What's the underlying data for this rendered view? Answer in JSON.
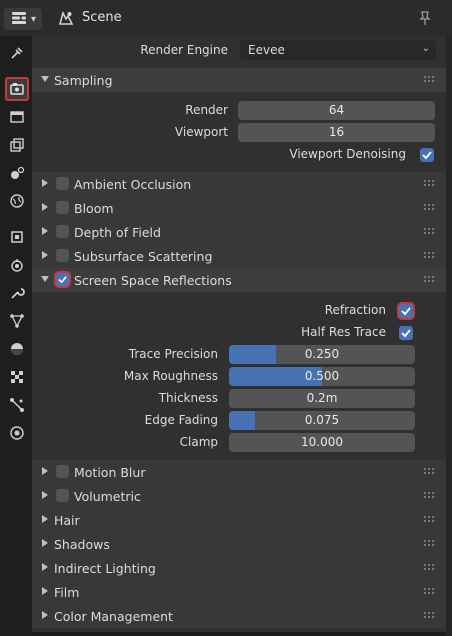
{
  "header": {
    "title": "Scene"
  },
  "tabs": [
    "tool-icon",
    "render-icon",
    "output-icon",
    "view-layer-icon",
    "scene-icon",
    "world-icon",
    "object-icon",
    "modifier-icon",
    "wrench-icon",
    "particles-icon",
    "physics-icon",
    "texture-icon",
    "constraints-icon",
    "data-icon"
  ],
  "render_engine": {
    "label": "Render Engine",
    "value": "Eevee"
  },
  "sampling": {
    "title": "Sampling",
    "render_label": "Render",
    "render_value": "64",
    "viewport_label": "Viewport",
    "viewport_value": "16",
    "denoise_label": "Viewport Denoising",
    "denoise_checked": true
  },
  "panels_top": [
    {
      "title": "Ambient Occlusion",
      "checked": false
    },
    {
      "title": "Bloom",
      "checked": false
    },
    {
      "title": "Depth of Field",
      "checked": false
    },
    {
      "title": "Subsurface Scattering",
      "checked": false
    }
  ],
  "ssr": {
    "title": "Screen Space Reflections",
    "checked": true,
    "refraction_label": "Refraction",
    "refraction_checked": true,
    "half_res_label": "Half Res Trace",
    "half_res_checked": true,
    "fields": [
      {
        "label": "Trace Precision",
        "value": "0.250",
        "fraction": 0.25
      },
      {
        "label": "Max Roughness",
        "value": "0.500",
        "fraction": 0.5
      },
      {
        "label": "Thickness",
        "value": "0.2m",
        "fraction": 0
      },
      {
        "label": "Edge Fading",
        "value": "0.075",
        "fraction": 0.14
      },
      {
        "label": "Clamp",
        "value": "10.000",
        "fraction": 0
      }
    ]
  },
  "panels_bottom": [
    {
      "title": "Motion Blur",
      "checkbox": true,
      "checked": false
    },
    {
      "title": "Volumetric",
      "checkbox": true,
      "checked": false
    },
    {
      "title": "Hair",
      "checkbox": false
    },
    {
      "title": "Shadows",
      "checkbox": false
    },
    {
      "title": "Indirect Lighting",
      "checkbox": false
    },
    {
      "title": "Film",
      "checkbox": false
    },
    {
      "title": "Color Management",
      "checkbox": false
    }
  ],
  "colors": {
    "accent": "#4772b3",
    "highlight": "#c8373b",
    "panel_header": "#3d3d3d",
    "background": "#303030"
  }
}
